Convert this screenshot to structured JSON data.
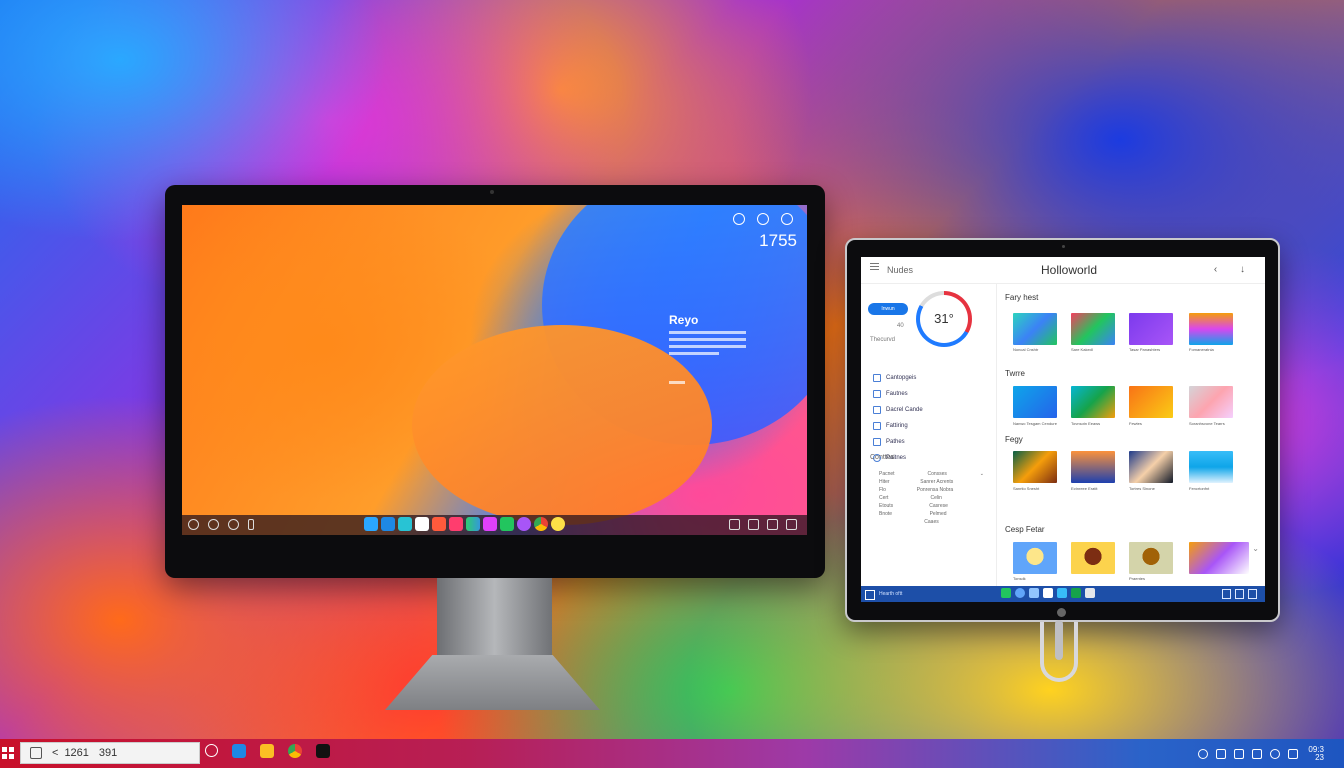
{
  "monitor": {
    "clock": "1755",
    "widget": {
      "heading": "Reyo"
    }
  },
  "tablet": {
    "nav_label": "Nudes",
    "title": "Holloworld",
    "pill_label": "Inwun",
    "sidebar_small": [
      "Thecurvd",
      "40"
    ],
    "gauge_value": "31°",
    "nav_items": [
      "Cantopgeis",
      "Fautnes",
      "Dacrel Cande",
      "Fattiring",
      "Pathes",
      "Paitnes"
    ],
    "section_label": "Conttos",
    "mini_table": [
      [
        "Pacnet",
        "Consses"
      ],
      [
        "Hiter",
        "Sanrer Acrents"
      ],
      [
        "Flo",
        "Ponrensa Nobra"
      ],
      [
        "Cert",
        "Celin"
      ],
      [
        "Etouts",
        "Casrese"
      ],
      [
        "Bnote",
        "Pelmed"
      ],
      [
        "",
        "Caaes"
      ]
    ],
    "sections": [
      {
        "heading": "Fary hest",
        "captions": [
          "Noncal Cnshtr",
          "Sare Kakedl",
          "Tasar Panashters",
          "Fomaneratnia"
        ]
      },
      {
        "heading": "Twrre",
        "captions": [
          "Nanwo Tesgam Cendure",
          "Tovnsotn Eeaws",
          "Fewtes",
          "Soranhsvone Tearrs"
        ]
      },
      {
        "heading": "Fegy",
        "captions": [
          "Sanrtio Snesht",
          "Ectnreee Eratit",
          "Tortres Sinone",
          "Fencrtonfnt"
        ]
      },
      {
        "heading": "Cesp Fetar",
        "captions": [
          "Tonsdk",
          "",
          "Praentes",
          ""
        ]
      }
    ],
    "taskbar_search": "Hearth oftt"
  },
  "taskbar": {
    "search_letter": "<",
    "search_text_1": "1261",
    "search_text_2": "391",
    "time_line1": "09:3",
    "time_line2": "23"
  }
}
